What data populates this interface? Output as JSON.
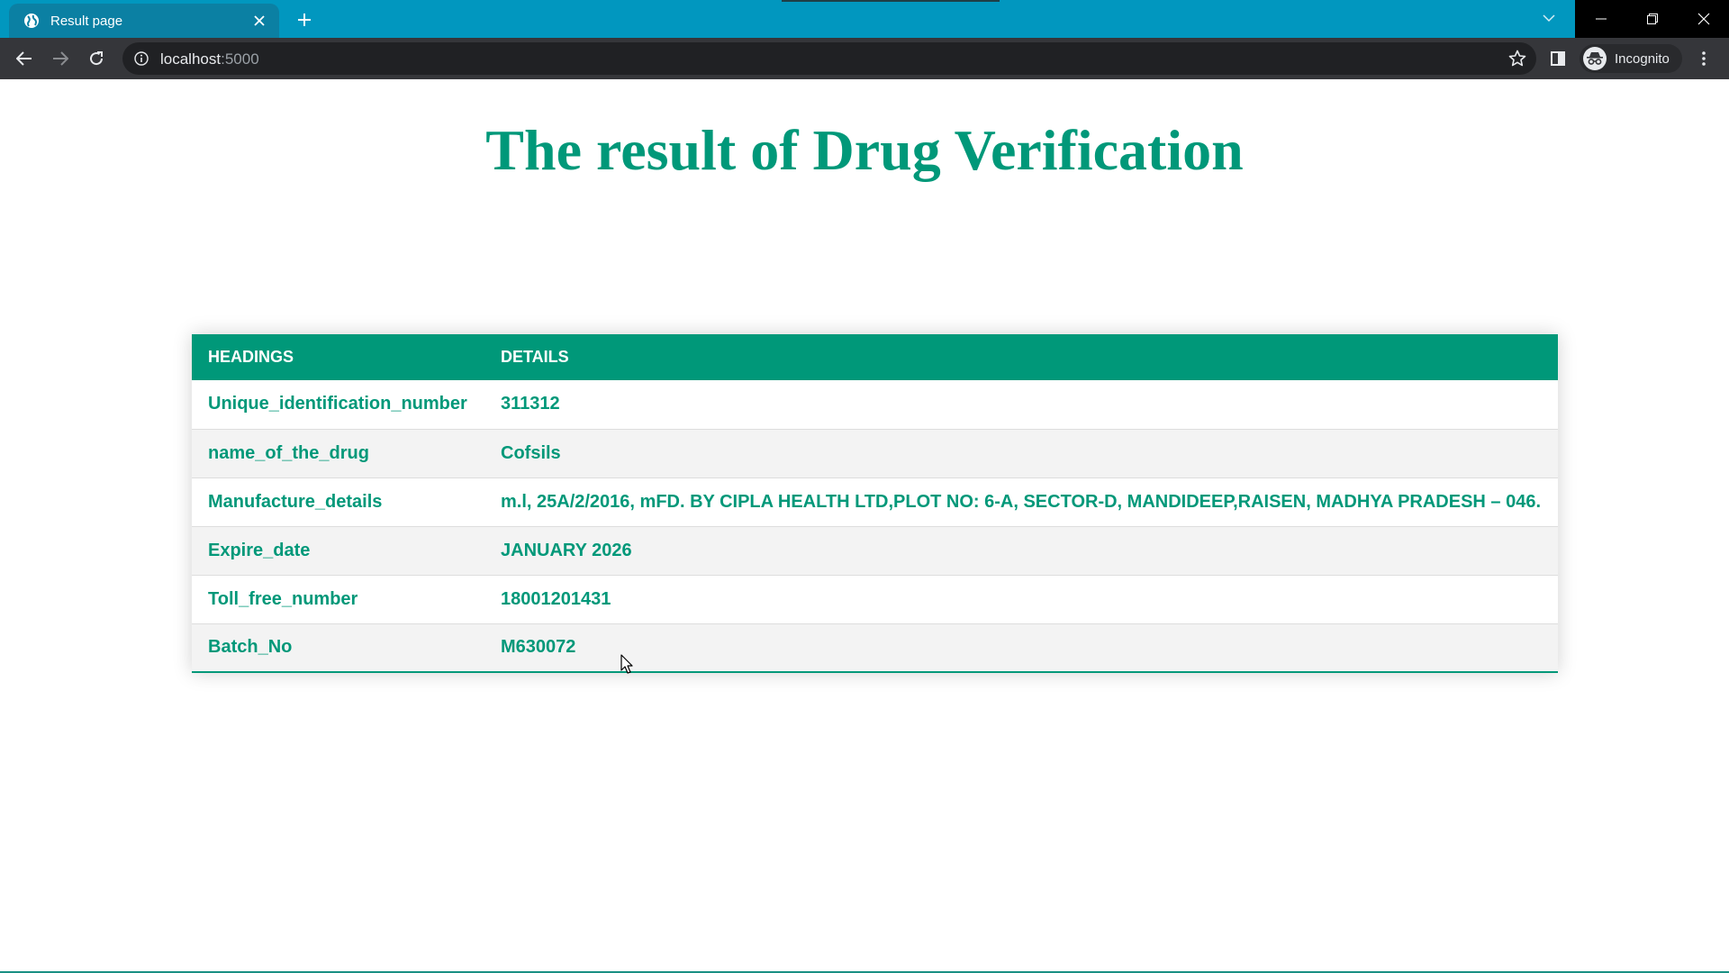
{
  "browser": {
    "tab": {
      "title": "Result page",
      "favicon": "globe-icon"
    },
    "new_tab_icon": "plus-icon",
    "tab_search_icon": "chevron-down-icon",
    "window_controls": [
      "minimize-icon",
      "restore-icon",
      "close-icon"
    ],
    "address": {
      "host": "localhost",
      "port": ":5000"
    },
    "profile": {
      "label": "Incognito",
      "icon": "incognito-icon"
    },
    "colors": {
      "tabstrip": "#0197bf",
      "active_tab": "#0b80a3",
      "toolbar": "#35363a",
      "omnibox": "#202124"
    }
  },
  "page": {
    "title": "The result of Drug Verification",
    "accent_color": "#009879",
    "table": {
      "headers": [
        "HEADINGS",
        "DETAILS"
      ],
      "rows": [
        {
          "heading": "Unique_identification_number",
          "detail": "311312"
        },
        {
          "heading": "name_of_the_drug",
          "detail": "Cofsils"
        },
        {
          "heading": "Manufacture_details",
          "detail": "m.l, 25A/2/2016, mFD. BY CIPLA HEALTH LTD,PLOT NO: 6-A, SECTOR-D, MANDIDEEP,RAISEN, MADHYA PRADESH – 046."
        },
        {
          "heading": "Expire_date",
          "detail": "JANUARY 2026"
        },
        {
          "heading": "Toll_free_number",
          "detail": "18001201431"
        },
        {
          "heading": "Batch_No",
          "detail": "M630072"
        }
      ]
    }
  }
}
